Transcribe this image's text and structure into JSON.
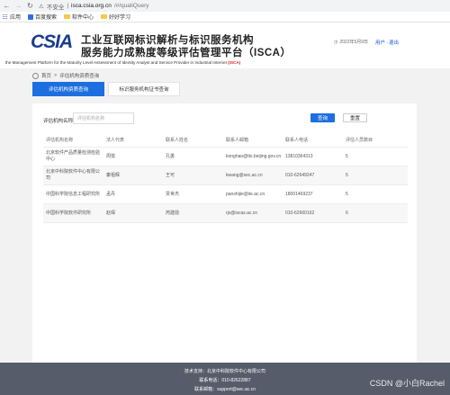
{
  "browser": {
    "security_label": "不安全",
    "url_host": "isca.csia.org.cn",
    "url_path": "/#/qualiQuery",
    "bookmarks": [
      "应用",
      "百度搜索",
      "软件中心",
      "好好学习"
    ]
  },
  "header": {
    "logo": "CSIA",
    "title_line1": "工业互联网标识解析与标识服务机构",
    "title_line2": "服务能力成熟度等级评估管理平台（ISCA）",
    "subtitle": "the Management Platform for the Maturity Level Assessment of Identity Analyst and Service Provider in Industrial Internet",
    "subtitle_tag": "(ISCA)",
    "date": "2022年5月9日",
    "user_link": "用户",
    "user_sep": "·",
    "logout_link": "退出"
  },
  "breadcrumb": {
    "home": "首页",
    "separator": ">",
    "current": "评估机构资质查询"
  },
  "tabs": [
    {
      "label": "评估机构资质查询",
      "active": true
    },
    {
      "label": "标识服务机构证书查询",
      "active": false
    }
  ],
  "search": {
    "label": "评估机构名称",
    "placeholder": "评估机构名称",
    "query_label": "查询",
    "reset_label": "重置"
  },
  "table": {
    "headers": [
      "评估机构名称",
      "法人代表",
      "联系人姓名",
      "联系人邮箱",
      "联系人电话",
      "评估人员数目"
    ],
    "rows": [
      [
        "北京软件产品质量检测检验中心",
        "周悦",
        "孔勇",
        "konghao@ttx.beijing.gov.cn",
        "13810364313",
        "5"
      ],
      [
        "北京中科院软件中心有限公司",
        "秦祖辉",
        "王可",
        "kwang@sec.ac.cn",
        "010-62649247",
        "5"
      ],
      [
        "中国科学院信息工程研究所",
        "孟丹",
        "贾世杰",
        "panshijie@iie.ac.cn",
        "18001469237",
        "5"
      ],
      [
        "中国科学院软件研究所",
        "赵琛",
        "芮建勋",
        "rjx@iscas.ac.cn",
        "010-62660162",
        "6"
      ]
    ]
  },
  "footer": {
    "line1": "技术支持：北京中科院软件中心有限公司",
    "line2": "联系电话：010-82622887",
    "line3": "联系邮箱：support@sec.ac.cn"
  },
  "watermark": "CSDN @小白Rachel",
  "colors": {
    "accent": "#1d6fe0",
    "brand_red": "#d9242b",
    "brand_blue": "#1a3c8c",
    "footer_bg": "#565c69"
  }
}
